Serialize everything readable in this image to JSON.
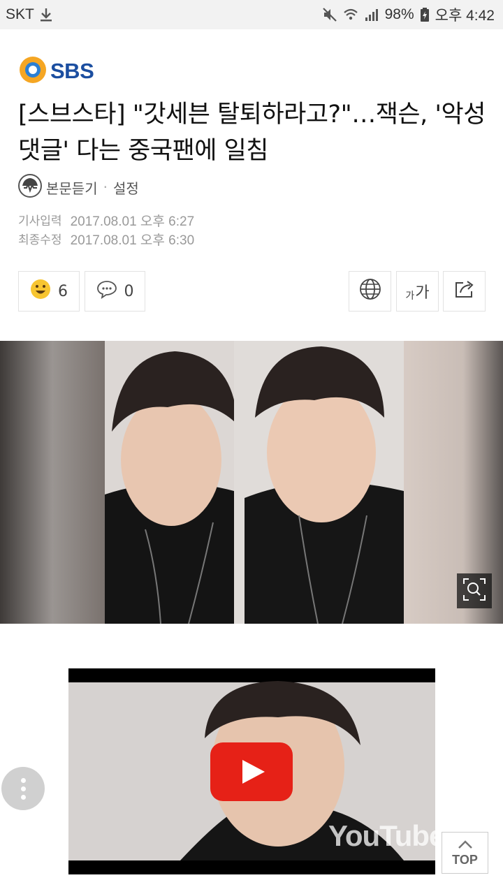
{
  "status_bar": {
    "carrier": "SKT",
    "battery": "98%",
    "time": "오후 4:42"
  },
  "publisher": {
    "logo_text": "SBS"
  },
  "article": {
    "headline": "[스브스타] \"갓세븐 탈퇴하라고?\"…잭슨, '악성 댓글' 다는 중국팬에 일침",
    "listen_label": "본문듣기",
    "settings_label": "설정",
    "dates": [
      {
        "label": "기사입력",
        "value": "2017.08.01 오후 6:27"
      },
      {
        "label": "최종수정",
        "value": "2017.08.01 오후 6:30"
      }
    ]
  },
  "actions": {
    "reaction_count": "6",
    "comment_count": "0",
    "font_label_small": "가",
    "font_label_large": "가"
  },
  "video": {
    "brand": "YouTube"
  },
  "floating": {
    "top_label": "TOP"
  },
  "colors": {
    "logo_blue": "#1b4ea0",
    "logo_orange": "#f5a623",
    "youtube_red": "#e62117"
  }
}
